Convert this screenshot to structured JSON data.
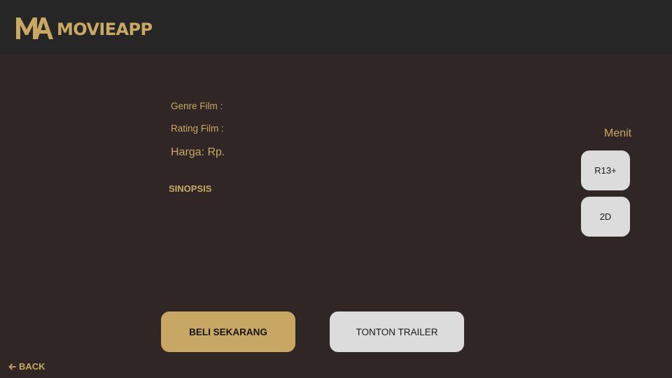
{
  "header": {
    "logo_icon": "ma-logo-icon",
    "brand_name": "MOVIEAPP"
  },
  "details": {
    "genre_label": "Genre Film :",
    "rating_label": "Rating Film :",
    "price_label": "Harga: Rp.",
    "synopsis_title": "SINOPSIS"
  },
  "side": {
    "duration_label": "Menit",
    "age_rating": "R13+",
    "format": "2D"
  },
  "actions": {
    "buy_label": "BELI SEKARANG",
    "trailer_label": "TONTON TRAILER"
  },
  "footer": {
    "back_icon": "arrow-left-icon",
    "back_label": "BACK"
  },
  "colors": {
    "background": "#302625",
    "header_bg": "#262626",
    "accent_gold": "#c9a864",
    "chip_bg": "#dcdcdc"
  }
}
